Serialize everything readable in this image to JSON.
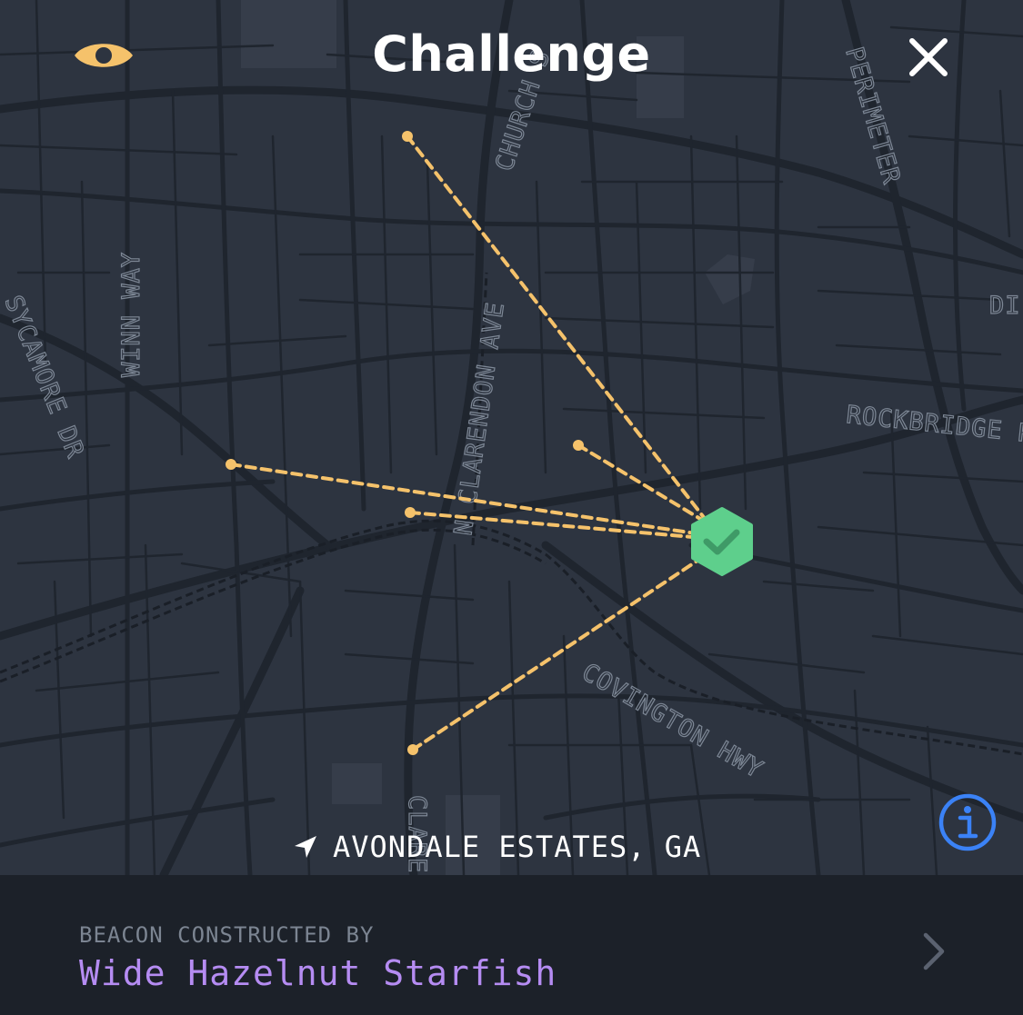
{
  "header": {
    "title": "Challenge",
    "left_icon": "eye-icon",
    "right_icon": "close-icon"
  },
  "map": {
    "road_labels": {
      "church": "CHURCH S",
      "perimeter": "PERIMETER",
      "winn": "WINN WAY",
      "sycamore": "SYCAMORE DR",
      "clarendon": "N CLARENDON AVE",
      "rockbridge": "ROCKBRIDGE R",
      "di": "DI",
      "covington": "COVINGTON HWY",
      "clar_bottom": "CLARE"
    },
    "location_label": "AVONDALE ESTATES, GA",
    "location_icon": "navigation-arrow-icon",
    "info_icon": "info-icon",
    "beacon_icon": "checkmark-hexagon-icon",
    "colors": {
      "background": "#2d3440",
      "roads": "#1f252e",
      "link_line": "#f5c26b",
      "beacon": "#5ecf8c",
      "info": "#3b82f6",
      "eye": "#f5c26b"
    }
  },
  "footer": {
    "caption": "BEACON CONSTRUCTED BY",
    "name": "Wide Hazelnut Starfish",
    "chevron_icon": "chevron-right-icon"
  }
}
